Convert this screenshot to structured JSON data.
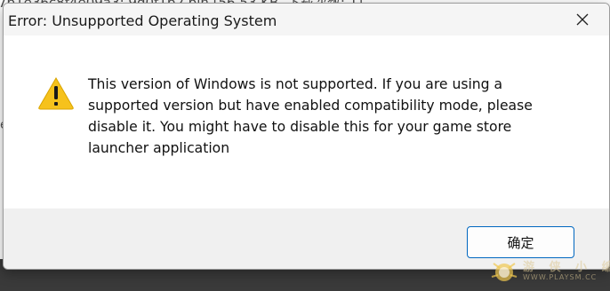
{
  "background": {
    "top_text": "7b1e36c8f4e09a3: 9d0f1b2.bin [56.53 KB, 下载次数: 1]",
    "left_glyph": "e"
  },
  "dialog": {
    "title": "Error: Unsupported Operating System",
    "message": "This version of Windows is not supported. If you are using a supported version but have enabled compatibility mode, please disable it. You might have to disable this for your game store launcher application",
    "ok_label": "确定",
    "close_icon": "close-icon",
    "warning_icon": "warning-icon"
  },
  "watermark": {
    "text": "游 侠 小 编",
    "url": "WWW.PLAYSM.CC"
  },
  "colors": {
    "accent": "#0067c0",
    "warning": "#f6c21c",
    "footer_bg": "#f0f0f0"
  }
}
